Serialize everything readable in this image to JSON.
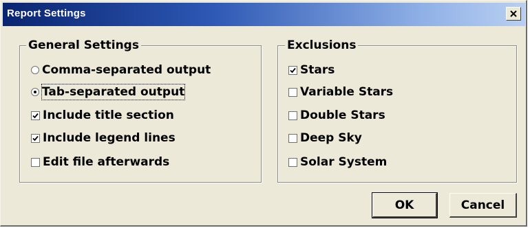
{
  "window": {
    "title": "Report Settings",
    "close_label": "×"
  },
  "general_settings": {
    "legend": "General Settings",
    "options": [
      {
        "label": "Comma-separated output",
        "type": "radio",
        "selected": false
      },
      {
        "label": "Tab-separated output",
        "type": "radio",
        "selected": true
      },
      {
        "label": "Include title section",
        "type": "checkbox",
        "checked": true
      },
      {
        "label": "Include legend lines",
        "type": "checkbox",
        "checked": true
      },
      {
        "label": "Edit file afterwards",
        "type": "checkbox",
        "checked": false
      }
    ]
  },
  "exclusions": {
    "legend": "Exclusions",
    "options": [
      {
        "label": "Stars",
        "checked": true
      },
      {
        "label": "Variable Stars",
        "checked": false
      },
      {
        "label": "Double Stars",
        "checked": false
      },
      {
        "label": "Deep Sky",
        "checked": false
      },
      {
        "label": "Solar System",
        "checked": false
      }
    ]
  },
  "buttons": {
    "ok": "OK",
    "cancel": "Cancel"
  },
  "colors": {
    "titlebar_start": "#0a2470",
    "titlebar_end": "#b9cff1",
    "dialog_face": "#ece9d8"
  }
}
